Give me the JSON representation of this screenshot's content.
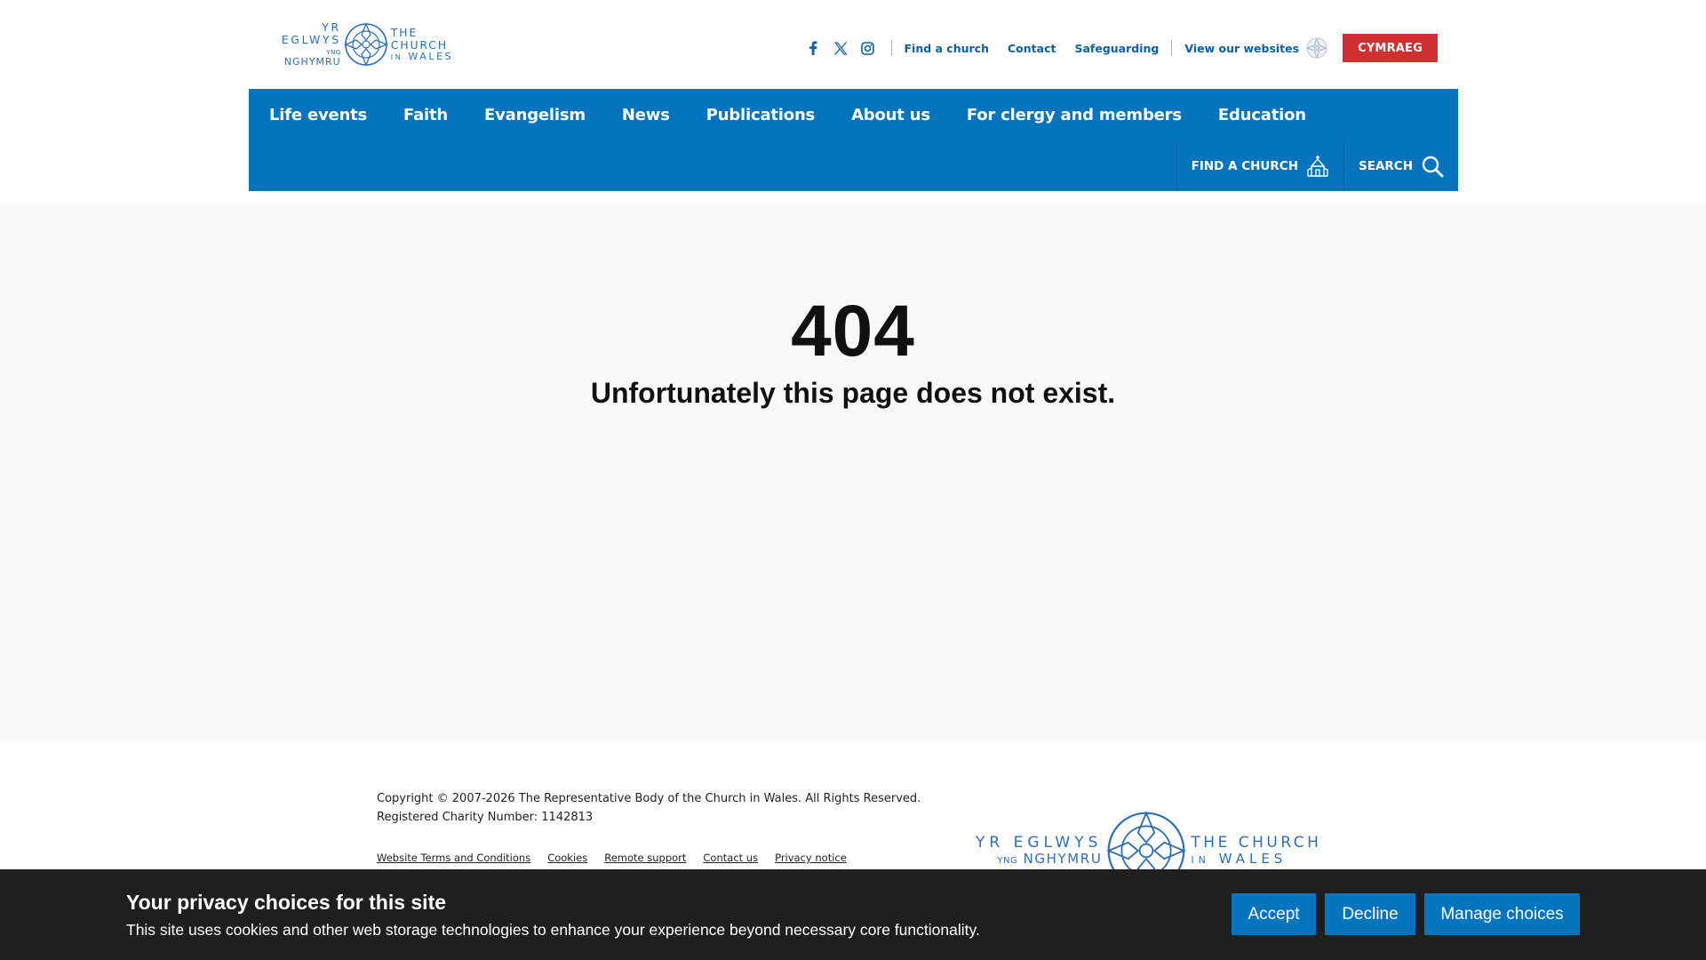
{
  "header": {
    "logo": {
      "left_line1": "YR EGLWYS",
      "left_line2_small": "YNG",
      "left_line2": "NGHYMRU",
      "right_line1": "THE CHURCH",
      "right_line2_small": "IN",
      "right_line2": "WALES"
    },
    "social_icons": [
      "facebook-icon",
      "x-twitter-icon",
      "instagram-icon"
    ],
    "utility_links": {
      "find_church": "Find a church",
      "contact": "Contact",
      "safeguarding": "Safeguarding",
      "websites": "View our websites",
      "language": "CYMRAEG"
    }
  },
  "nav": {
    "items": [
      "Life events",
      "Faith",
      "Evangelism",
      "News",
      "Publications",
      "About us",
      "For clergy and members",
      "Education"
    ],
    "find_church": "FIND A CHURCH",
    "search": "SEARCH"
  },
  "error": {
    "code": "404",
    "message": "Unfortunately this page does not exist."
  },
  "footer": {
    "copyright": "Copyright © 2007-2026 The Representative Body of the Church in Wales. All Rights Reserved.",
    "charity": "Registered Charity Number: 1142813",
    "links": [
      "Website Terms and Conditions",
      "Cookies",
      "Remote support",
      "Contact us",
      "Privacy notice"
    ]
  },
  "cookie_banner": {
    "title": "Your privacy choices for this site",
    "text": "This site uses cookies and other web storage technologies to enhance your experience beyond necessary core functionality.",
    "accept": "Accept",
    "decline": "Decline",
    "manage": "Manage choices"
  },
  "colors": {
    "brand_blue": "#0474bf",
    "link_blue": "#0d5fa6",
    "cymraeg_red": "#d0302f",
    "banner_dark": "#1f1f1f"
  }
}
